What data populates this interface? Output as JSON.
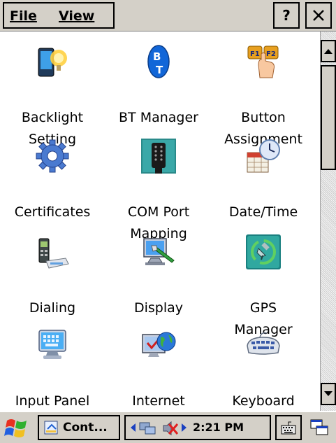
{
  "menubar": {
    "file_label": "File",
    "view_label": "View",
    "help_label": "?"
  },
  "items": [
    {
      "label": "Backlight\nSetting",
      "icon": "backlight-icon"
    },
    {
      "label": "BT Manager",
      "icon": "bluetooth-icon"
    },
    {
      "label": "Button\nAssignment",
      "icon": "button-assignment-icon"
    },
    {
      "label": "Certificates",
      "icon": "certificates-gear-icon"
    },
    {
      "label": "COM Port\nMapping",
      "icon": "com-port-icon"
    },
    {
      "label": "Date/Time",
      "icon": "calendar-clock-icon"
    },
    {
      "label": "Dialing",
      "icon": "phone-modem-icon"
    },
    {
      "label": "Display",
      "icon": "monitor-brush-icon"
    },
    {
      "label": "GPS\nManager",
      "icon": "gps-satellite-icon"
    },
    {
      "label": "Input Panel",
      "icon": "keyboard-monitor-icon"
    },
    {
      "label": "Internet\nOptions",
      "icon": "globe-monitor-icon"
    },
    {
      "label": "Keyboard",
      "icon": "keyboard-icon"
    }
  ],
  "taskbar": {
    "task_label": "Cont...",
    "clock": "2:21 PM"
  },
  "colors": {
    "chrome": "#d4d0c8",
    "window": "#ffffff",
    "text": "#000000"
  }
}
